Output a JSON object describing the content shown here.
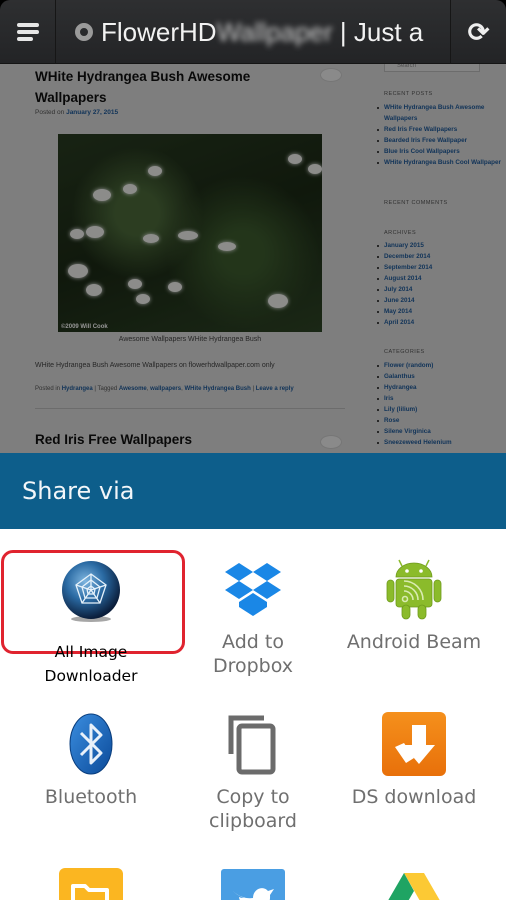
{
  "browser": {
    "title_visible": "FlowerHD",
    "title_blurred": "Wallpaper",
    "title_tail": " | Just a",
    "menu_icon": "hamburger-menu-icon",
    "site_icon": "globe-icon",
    "reload_icon": "reload-icon",
    "reload_glyph": "⟳"
  },
  "webpage": {
    "post1": {
      "title": "WHite Hydrangea Bush Awesome Wallpapers",
      "posted_prefix": "Posted on ",
      "date": "January 27, 2015",
      "image_credit": "©2009 Will Cook",
      "caption": "Awesome Wallpapers WHite Hydrangea Bush",
      "excerpt": "WHite Hydrangea Bush Awesome Wallpapers on flowerhdwallpaper.com only",
      "meta_posted_in": "Posted in ",
      "category": "Hydrangea",
      "meta_tagged": " | Tagged ",
      "tags": [
        "Awesome",
        "wallpapers",
        "WHite Hydrangea Bush"
      ],
      "meta_sep": " | ",
      "reply_link": "Leave a reply"
    },
    "post2": {
      "title": "Red Iris Free Wallpapers"
    },
    "sidebar": {
      "search_placeholder": "Search",
      "recent_posts_heading": "RECENT POSTS",
      "recent_posts": [
        "WHite Hydrangea Bush Awesome Wallpapers",
        "Red Iris Free Wallpapers",
        "Bearded Iris Free Wallpaper",
        "Blue Iris Cool Wallpapers",
        "WHite Hydrangea Bush Cool Wallpaper"
      ],
      "recent_comments_heading": "RECENT COMMENTS",
      "archives_heading": "ARCHIVES",
      "archives": [
        "January 2015",
        "December 2014",
        "September 2014",
        "August 2014",
        "July 2014",
        "June 2014",
        "May 2014",
        "April 2014"
      ],
      "categories_heading": "CATEGORIES",
      "categories": [
        "Flower (random)",
        "Galanthus",
        "Hydrangea",
        "Iris",
        "Lily (lilium)",
        "Rose",
        "Silene Virginica",
        "Sneezeweed Helenium"
      ]
    }
  },
  "share_sheet": {
    "title": "Share via",
    "accent_color": "#0d5e8b",
    "highlight_color": "#e0232f",
    "targets": [
      {
        "label": "All Image Downloader",
        "icon": "spider-web-globe-icon",
        "highlighted": true
      },
      {
        "label": "Add to Dropbox",
        "label_line1": "Add to",
        "label_line2": "Dropbox",
        "icon": "dropbox-icon"
      },
      {
        "label": "Android Beam",
        "icon": "android-beam-icon"
      },
      {
        "label": "Bluetooth",
        "icon": "bluetooth-icon"
      },
      {
        "label": "Copy to clipboard",
        "label_line1": "Copy to",
        "label_line2": "clipboard",
        "icon": "copy-icon"
      },
      {
        "label": "DS download",
        "icon": "ds-download-icon"
      },
      {
        "label": "",
        "icon": "file-manager-icon"
      },
      {
        "label": "",
        "icon": "twitter-icon"
      },
      {
        "label": "",
        "icon": "google-drive-icon"
      }
    ]
  }
}
